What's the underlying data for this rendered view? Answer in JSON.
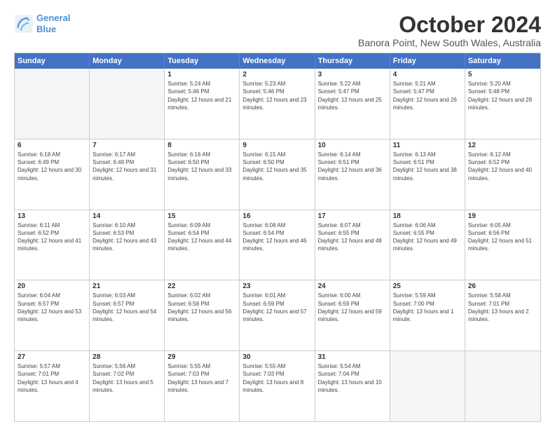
{
  "header": {
    "logo_line1": "General",
    "logo_line2": "Blue",
    "month": "October 2024",
    "location": "Banora Point, New South Wales, Australia"
  },
  "days_of_week": [
    "Sunday",
    "Monday",
    "Tuesday",
    "Wednesday",
    "Thursday",
    "Friday",
    "Saturday"
  ],
  "weeks": [
    [
      {
        "num": "",
        "empty": true,
        "sunrise": "",
        "sunset": "",
        "daylight": ""
      },
      {
        "num": "",
        "empty": true,
        "sunrise": "",
        "sunset": "",
        "daylight": ""
      },
      {
        "num": "1",
        "empty": false,
        "sunrise": "Sunrise: 5:24 AM",
        "sunset": "Sunset: 5:46 PM",
        "daylight": "Daylight: 12 hours and 21 minutes."
      },
      {
        "num": "2",
        "empty": false,
        "sunrise": "Sunrise: 5:23 AM",
        "sunset": "Sunset: 5:46 PM",
        "daylight": "Daylight: 12 hours and 23 minutes."
      },
      {
        "num": "3",
        "empty": false,
        "sunrise": "Sunrise: 5:22 AM",
        "sunset": "Sunset: 5:47 PM",
        "daylight": "Daylight: 12 hours and 25 minutes."
      },
      {
        "num": "4",
        "empty": false,
        "sunrise": "Sunrise: 5:21 AM",
        "sunset": "Sunset: 5:47 PM",
        "daylight": "Daylight: 12 hours and 26 minutes."
      },
      {
        "num": "5",
        "empty": false,
        "sunrise": "Sunrise: 5:20 AM",
        "sunset": "Sunset: 5:48 PM",
        "daylight": "Daylight: 12 hours and 28 minutes."
      }
    ],
    [
      {
        "num": "6",
        "empty": false,
        "sunrise": "Sunrise: 6:18 AM",
        "sunset": "Sunset: 6:49 PM",
        "daylight": "Daylight: 12 hours and 30 minutes."
      },
      {
        "num": "7",
        "empty": false,
        "sunrise": "Sunrise: 6:17 AM",
        "sunset": "Sunset: 6:49 PM",
        "daylight": "Daylight: 12 hours and 31 minutes."
      },
      {
        "num": "8",
        "empty": false,
        "sunrise": "Sunrise: 6:16 AM",
        "sunset": "Sunset: 6:50 PM",
        "daylight": "Daylight: 12 hours and 33 minutes."
      },
      {
        "num": "9",
        "empty": false,
        "sunrise": "Sunrise: 6:15 AM",
        "sunset": "Sunset: 6:50 PM",
        "daylight": "Daylight: 12 hours and 35 minutes."
      },
      {
        "num": "10",
        "empty": false,
        "sunrise": "Sunrise: 6:14 AM",
        "sunset": "Sunset: 6:51 PM",
        "daylight": "Daylight: 12 hours and 36 minutes."
      },
      {
        "num": "11",
        "empty": false,
        "sunrise": "Sunrise: 6:13 AM",
        "sunset": "Sunset: 6:51 PM",
        "daylight": "Daylight: 12 hours and 38 minutes."
      },
      {
        "num": "12",
        "empty": false,
        "sunrise": "Sunrise: 6:12 AM",
        "sunset": "Sunset: 6:52 PM",
        "daylight": "Daylight: 12 hours and 40 minutes."
      }
    ],
    [
      {
        "num": "13",
        "empty": false,
        "sunrise": "Sunrise: 6:11 AM",
        "sunset": "Sunset: 6:52 PM",
        "daylight": "Daylight: 12 hours and 41 minutes."
      },
      {
        "num": "14",
        "empty": false,
        "sunrise": "Sunrise: 6:10 AM",
        "sunset": "Sunset: 6:53 PM",
        "daylight": "Daylight: 12 hours and 43 minutes."
      },
      {
        "num": "15",
        "empty": false,
        "sunrise": "Sunrise: 6:09 AM",
        "sunset": "Sunset: 6:54 PM",
        "daylight": "Daylight: 12 hours and 44 minutes."
      },
      {
        "num": "16",
        "empty": false,
        "sunrise": "Sunrise: 6:08 AM",
        "sunset": "Sunset: 6:54 PM",
        "daylight": "Daylight: 12 hours and 46 minutes."
      },
      {
        "num": "17",
        "empty": false,
        "sunrise": "Sunrise: 6:07 AM",
        "sunset": "Sunset: 6:55 PM",
        "daylight": "Daylight: 12 hours and 48 minutes."
      },
      {
        "num": "18",
        "empty": false,
        "sunrise": "Sunrise: 6:06 AM",
        "sunset": "Sunset: 6:55 PM",
        "daylight": "Daylight: 12 hours and 49 minutes."
      },
      {
        "num": "19",
        "empty": false,
        "sunrise": "Sunrise: 6:05 AM",
        "sunset": "Sunset: 6:56 PM",
        "daylight": "Daylight: 12 hours and 51 minutes."
      }
    ],
    [
      {
        "num": "20",
        "empty": false,
        "sunrise": "Sunrise: 6:04 AM",
        "sunset": "Sunset: 6:57 PM",
        "daylight": "Daylight: 12 hours and 53 minutes."
      },
      {
        "num": "21",
        "empty": false,
        "sunrise": "Sunrise: 6:03 AM",
        "sunset": "Sunset: 6:57 PM",
        "daylight": "Daylight: 12 hours and 54 minutes."
      },
      {
        "num": "22",
        "empty": false,
        "sunrise": "Sunrise: 6:02 AM",
        "sunset": "Sunset: 6:58 PM",
        "daylight": "Daylight: 12 hours and 56 minutes."
      },
      {
        "num": "23",
        "empty": false,
        "sunrise": "Sunrise: 6:01 AM",
        "sunset": "Sunset: 6:59 PM",
        "daylight": "Daylight: 12 hours and 57 minutes."
      },
      {
        "num": "24",
        "empty": false,
        "sunrise": "Sunrise: 6:00 AM",
        "sunset": "Sunset: 6:59 PM",
        "daylight": "Daylight: 12 hours and 59 minutes."
      },
      {
        "num": "25",
        "empty": false,
        "sunrise": "Sunrise: 5:59 AM",
        "sunset": "Sunset: 7:00 PM",
        "daylight": "Daylight: 13 hours and 1 minute."
      },
      {
        "num": "26",
        "empty": false,
        "sunrise": "Sunrise: 5:58 AM",
        "sunset": "Sunset: 7:01 PM",
        "daylight": "Daylight: 13 hours and 2 minutes."
      }
    ],
    [
      {
        "num": "27",
        "empty": false,
        "sunrise": "Sunrise: 5:57 AM",
        "sunset": "Sunset: 7:01 PM",
        "daylight": "Daylight: 13 hours and 4 minutes."
      },
      {
        "num": "28",
        "empty": false,
        "sunrise": "Sunrise: 5:56 AM",
        "sunset": "Sunset: 7:02 PM",
        "daylight": "Daylight: 13 hours and 5 minutes."
      },
      {
        "num": "29",
        "empty": false,
        "sunrise": "Sunrise: 5:55 AM",
        "sunset": "Sunset: 7:03 PM",
        "daylight": "Daylight: 13 hours and 7 minutes."
      },
      {
        "num": "30",
        "empty": false,
        "sunrise": "Sunrise: 5:55 AM",
        "sunset": "Sunset: 7:03 PM",
        "daylight": "Daylight: 13 hours and 8 minutes."
      },
      {
        "num": "31",
        "empty": false,
        "sunrise": "Sunrise: 5:54 AM",
        "sunset": "Sunset: 7:04 PM",
        "daylight": "Daylight: 13 hours and 10 minutes."
      },
      {
        "num": "",
        "empty": true,
        "sunrise": "",
        "sunset": "",
        "daylight": ""
      },
      {
        "num": "",
        "empty": true,
        "sunrise": "",
        "sunset": "",
        "daylight": ""
      }
    ]
  ]
}
